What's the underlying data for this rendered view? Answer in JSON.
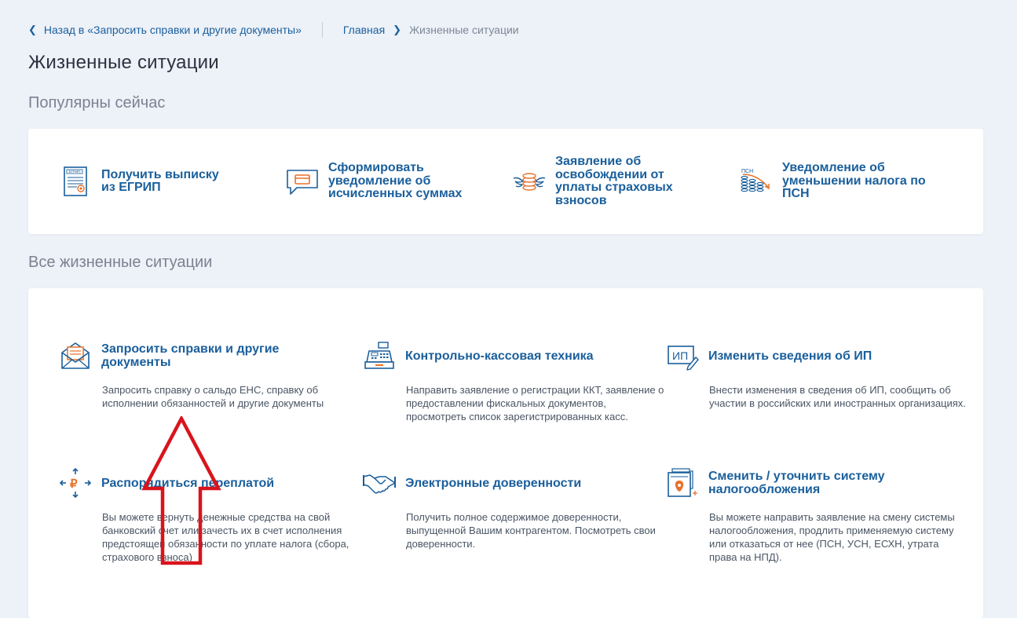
{
  "breadcrumbs": {
    "back_label": "Назад в «Запросить справки и другие документы»",
    "home": "Главная",
    "current": "Жизненные ситуации"
  },
  "page_title": "Жизненные ситуации",
  "popular": {
    "title": "Популярны сейчас",
    "items": [
      {
        "label": "Получить выписку из ЕГРИП",
        "icon": "egrip-document-icon"
      },
      {
        "label": "Сформировать уведомление об исчисленных суммах",
        "icon": "speech-bubble-card-icon"
      },
      {
        "label": "Заявление об освобождении от уплаты страховых взносов",
        "icon": "winged-coins-icon"
      },
      {
        "label": "Уведомление об уменьшении налога по ПСН",
        "icon": "psn-coin-stacks-icon"
      }
    ]
  },
  "all": {
    "title": "Все жизненные ситуации",
    "items": [
      {
        "title": "Запросить справки и другие документы",
        "desc": "Запросить справку о сальдо ЕНС, справку об исполнении обязанностей и другие документы",
        "icon": "envelope-letter-icon"
      },
      {
        "title": "Контрольно-кассовая техника",
        "desc": "Направить заявление о регистрации ККТ, заявление о предоставлении фискальных документов, просмотреть список зарегистрированных касс.",
        "icon": "cash-register-icon"
      },
      {
        "title": "Изменить сведения об ИП",
        "desc": "Внести изменения в сведения об ИП, сообщить об участии в российских или иностранных организациях.",
        "icon": "ip-edit-icon"
      },
      {
        "title": "Распорядиться переплатой",
        "desc": "Вы можете вернуть денежные средства на свой банковский счет или зачесть их в счет исполнения предстоящей обязанности по уплате налога (сбора, страхового взноса)",
        "icon": "ruble-arrows-icon"
      },
      {
        "title": "Электронные доверенности",
        "desc": "Получить полное содержимое доверенности, выпущенной Вашим контрагентом. Посмотреть свои доверенности.",
        "icon": "handshake-icon"
      },
      {
        "title": "Сменить / уточнить систему налогообложения",
        "desc": "Вы можете направить заявление на смену системы налогообложения, продлить применяемую систему или отказаться от нее (ПСН, УСН, ЕСХН, утрата права на НПД).",
        "icon": "emblem-folder-icon"
      }
    ]
  },
  "annotation": {
    "icon": "red-up-arrow-icon",
    "color": "#d9141c"
  },
  "colors": {
    "accent": "#1a5f9c",
    "icon_orange": "#e8712b",
    "background": "#edf1f8"
  }
}
